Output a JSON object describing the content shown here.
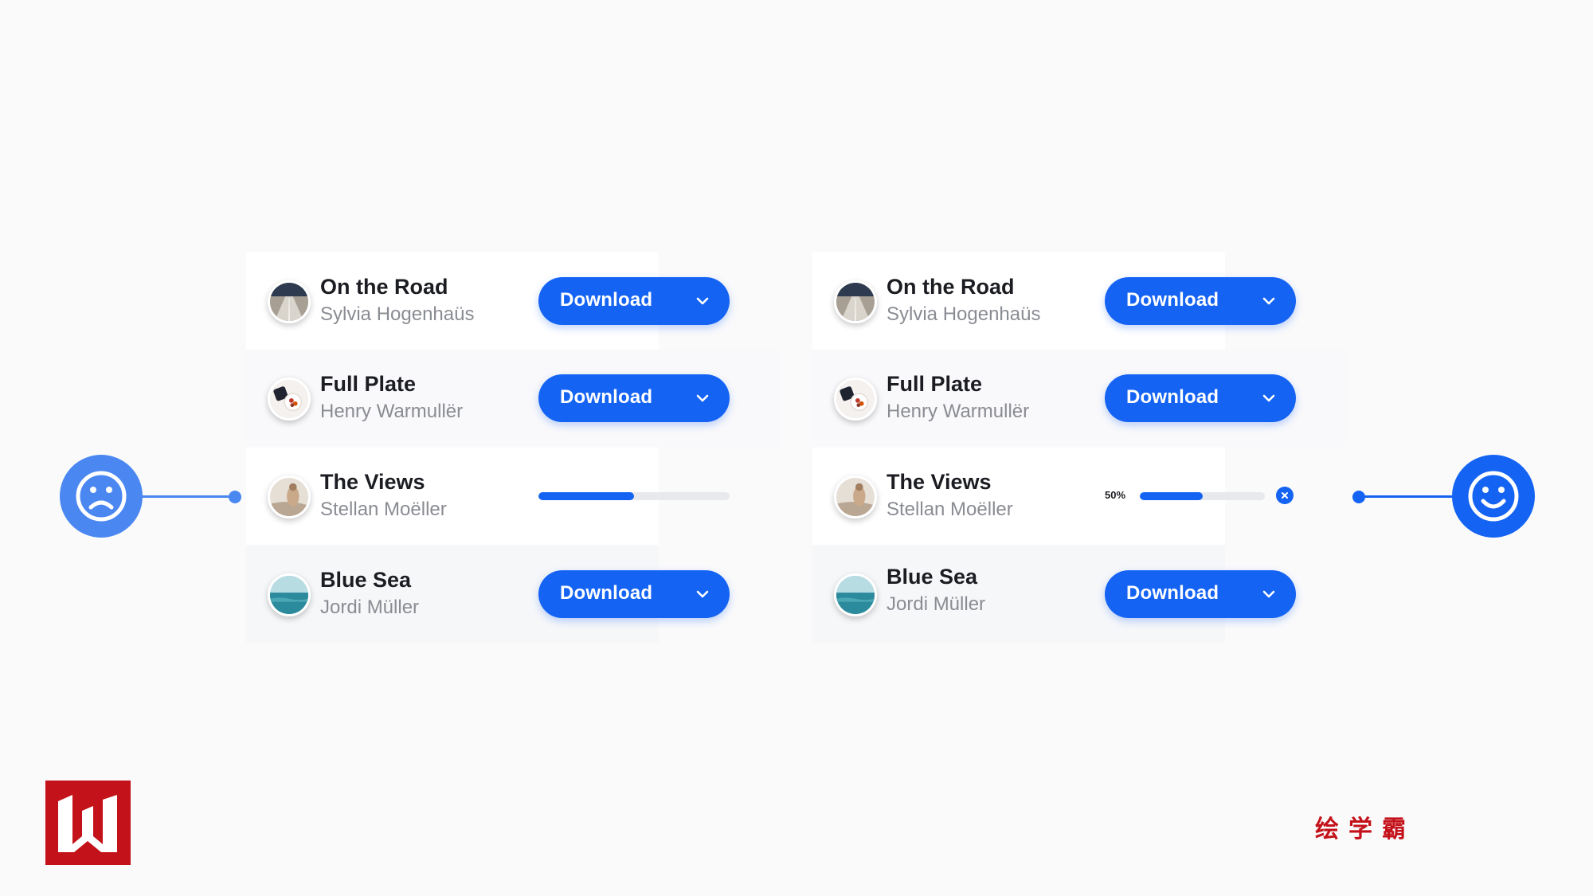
{
  "colors": {
    "accent": "#1463f3",
    "accent_soft": "#4a87f1",
    "title_text": "#1c1d22",
    "subtitle_text": "#8a8c93",
    "track": "#e8e9ed",
    "brand_red": "#c4121a"
  },
  "before": {
    "icon": "sad-face-icon",
    "items": [
      {
        "title": "On the Road",
        "author": "Sylvia Hogenhaüs",
        "button": "Download"
      },
      {
        "title": "Full Plate",
        "author": "Henry Warmullër",
        "button": "Download"
      },
      {
        "title": "The Views",
        "author": "Stellan Moëller",
        "progress": 0.5
      },
      {
        "title": "Blue Sea",
        "author": "Jordi Müller",
        "button": "Download"
      }
    ]
  },
  "after": {
    "icon": "happy-face-icon",
    "items": [
      {
        "title": "On the Road",
        "author": "Sylvia Hogenhaüs",
        "button": "Download"
      },
      {
        "title": "Full Plate",
        "author": "Henry Warmullër",
        "button": "Download"
      },
      {
        "title": "The Views",
        "author": "Stellan Moëller",
        "progress": 0.5,
        "progress_label": "50%"
      },
      {
        "title": "Blue Sea",
        "author": "Jordi Müller",
        "button": "Download"
      }
    ]
  },
  "branding": {
    "logo_icon": "w-logo-icon",
    "chinese_name": "绘学霸"
  }
}
